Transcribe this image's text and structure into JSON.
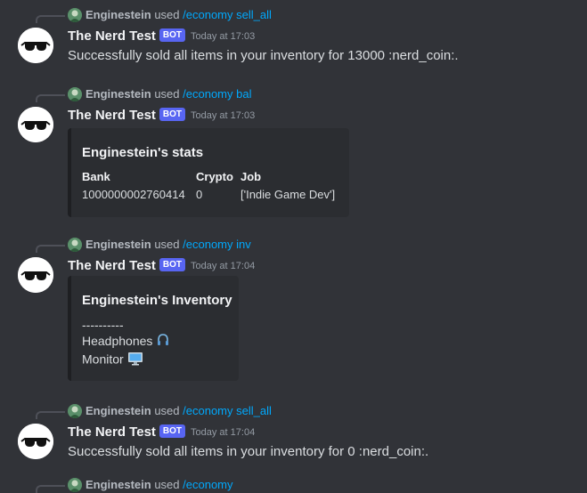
{
  "messages": [
    {
      "reply": {
        "user": "Enginestein",
        "used": "used",
        "command": "/economy sell_all"
      },
      "author": "The Nerd Test",
      "bot_tag": "BOT",
      "timestamp": "Today at 17:03",
      "content": "Successfully sold all items in your inventory for 13000 :nerd_coin:."
    },
    {
      "reply": {
        "user": "Enginestein",
        "used": "used",
        "command": "/economy bal"
      },
      "author": "The Nerd Test",
      "bot_tag": "BOT",
      "timestamp": "Today at 17:03",
      "embed": {
        "title": "Enginestein's stats",
        "fields": [
          {
            "name": "Bank",
            "value": "1000000002760414"
          },
          {
            "name": "Crypto",
            "value": "0"
          },
          {
            "name": "Job",
            "value": "['Indie Game Dev']"
          }
        ]
      }
    },
    {
      "reply": {
        "user": "Enginestein",
        "used": "used",
        "command": "/economy inv"
      },
      "author": "The Nerd Test",
      "bot_tag": "BOT",
      "timestamp": "Today at 17:04",
      "embed": {
        "title": "Enginestein's Inventory",
        "separator": "----------",
        "items": [
          {
            "name": "Headphones",
            "icon": "headphones-icon"
          },
          {
            "name": "Monitor",
            "icon": "monitor-icon"
          }
        ]
      }
    },
    {
      "reply": {
        "user": "Enginestein",
        "used": "used",
        "command": "/economy sell_all"
      },
      "author": "The Nerd Test",
      "bot_tag": "BOT",
      "timestamp": "Today at 17:04",
      "content": "Successfully sold all items in your inventory for 0 :nerd_coin:."
    }
  ],
  "partial_reply": {
    "user": "Enginestein",
    "used": "used",
    "command": "/economy"
  },
  "colors": {
    "background": "#313338",
    "embed": "#2b2d31",
    "command": "#00a8fc",
    "bot_tag": "#5865f2"
  }
}
